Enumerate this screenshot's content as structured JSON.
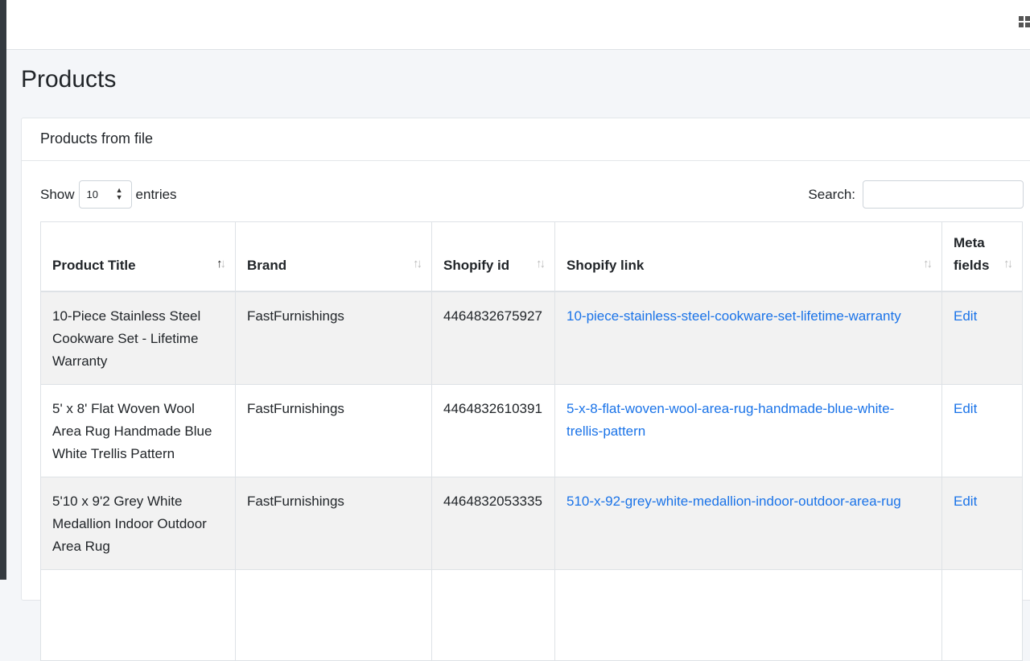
{
  "page": {
    "title": "Products"
  },
  "card": {
    "header": "Products from file"
  },
  "controls": {
    "show_label": "Show",
    "entries_label": "entries",
    "page_length": "10",
    "search_label": "Search:",
    "search_value": ""
  },
  "table": {
    "columns": [
      {
        "label": "Product Title",
        "sort": "ascending"
      },
      {
        "label": "Brand",
        "sort": "none"
      },
      {
        "label": "Shopify id",
        "sort": "none"
      },
      {
        "label": "Shopify link",
        "sort": "none"
      },
      {
        "label": "Meta fields",
        "sort": "none"
      }
    ],
    "rows": [
      {
        "title": "10-Piece Stainless Steel Cookware Set - Lifetime Warranty",
        "brand": "FastFurnishings",
        "shopify_id": "4464832675927",
        "shopify_link": "10-piece-stainless-steel-cookware-set-lifetime-warranty",
        "meta": "Edit"
      },
      {
        "title": "5' x 8' Flat Woven Wool Area Rug Handmade Blue White Trellis Pattern",
        "brand": "FastFurnishings",
        "shopify_id": "4464832610391",
        "shopify_link": "5-x-8-flat-woven-wool-area-rug-handmade-blue-white-trellis-pattern",
        "meta": "Edit"
      },
      {
        "title": "5'10 x 9'2 Grey White Medallion Indoor Outdoor Area Rug",
        "brand": "FastFurnishings",
        "shopify_id": "4464832053335",
        "shopify_link": "510-x-92-grey-white-medallion-indoor-outdoor-area-rug",
        "meta": "Edit"
      }
    ]
  },
  "icons": {
    "apps": "apps-grid-icon",
    "sort": "sort-arrows-icon"
  },
  "colors": {
    "link": "#1a73e8",
    "striped_row": "#f2f2f2",
    "sidebar": "#343a40"
  }
}
